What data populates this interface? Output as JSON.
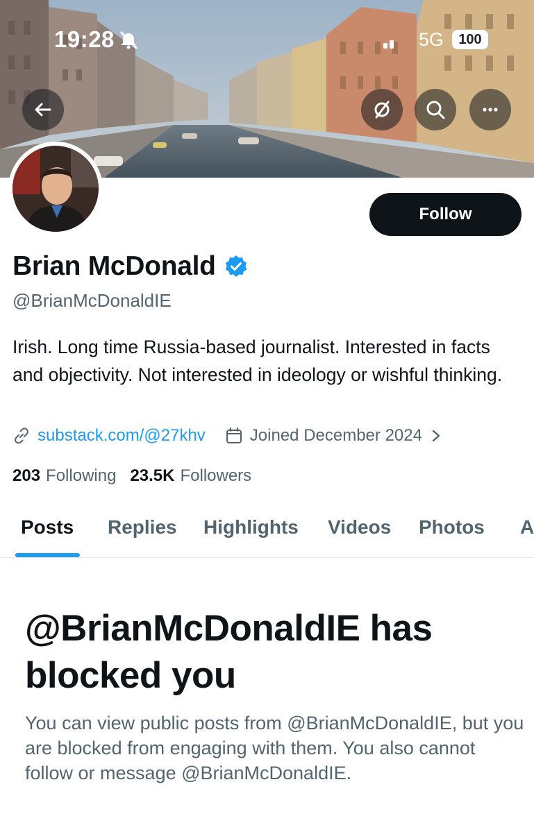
{
  "status_bar": {
    "time": "19:28",
    "network": "5G",
    "battery": "100",
    "icons": [
      "bell-muted-icon",
      "signal-icon"
    ]
  },
  "header": {
    "buttons": [
      "back-arrow-icon",
      "grok-icon",
      "search-icon",
      "more-icon"
    ]
  },
  "profile": {
    "follow_label": "Follow",
    "name": "Brian McDonald",
    "handle": "@BrianMcDonaldIE",
    "bio": "Irish. Long time Russia-based journalist. Interested in facts and objectivity. Not interested in ideology or wishful thinking.",
    "link": "substack.com/@27khv",
    "joined": "Joined December 2024",
    "following_count": "203",
    "following_label": "Following",
    "followers_count": "23.5K",
    "followers_label": "Followers"
  },
  "tabs": [
    {
      "label": "Posts",
      "active": true
    },
    {
      "label": "Replies"
    },
    {
      "label": "Highlights"
    },
    {
      "label": "Videos"
    },
    {
      "label": "Photos"
    },
    {
      "label": "A"
    }
  ],
  "blocked": {
    "title": "@BrianMcDonaldIE has blocked you",
    "body": "You can view public posts from @BrianMcDonaldIE, but you are blocked from engaging with them. You also cannot follow or message @BrianMcDonaldIE."
  },
  "colors": {
    "accent": "#1d9bf0",
    "text_primary": "#0f1419",
    "text_secondary": "#536471",
    "follow_button": "#0f1419"
  }
}
